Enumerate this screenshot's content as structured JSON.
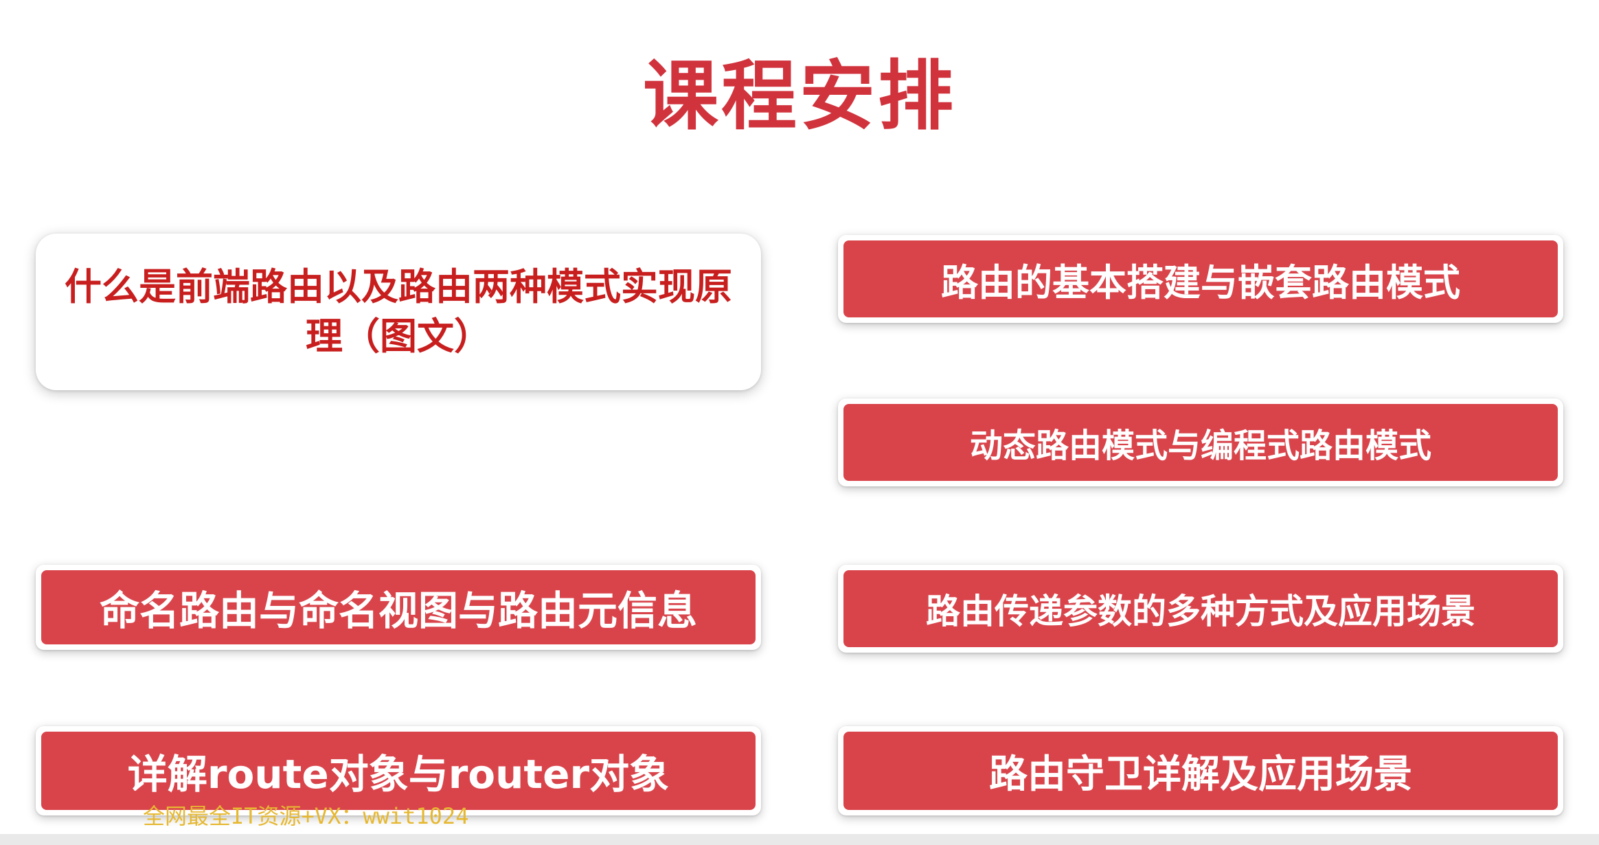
{
  "title": "课程安排",
  "items": [
    {
      "label": "什么是前端路由以及路由两种模式实现原理（图文）"
    },
    {
      "label": "路由的基本搭建与嵌套路由模式"
    },
    {
      "label": "动态路由模式与编程式路由模式"
    },
    {
      "label": "命名路由与命名视图与路由元信息"
    },
    {
      "label": "路由传递参数的多种方式及应用场景"
    },
    {
      "label": "详解route对象与router对象"
    },
    {
      "label": "路由守卫详解及应用场景"
    }
  ],
  "watermark": "全网最全IT资源+VX：wwit1024",
  "colors": {
    "accent": "#d9444b",
    "title": "#d1333d",
    "highlight_text": "#c81e1e",
    "watermark": "#e6b830"
  }
}
